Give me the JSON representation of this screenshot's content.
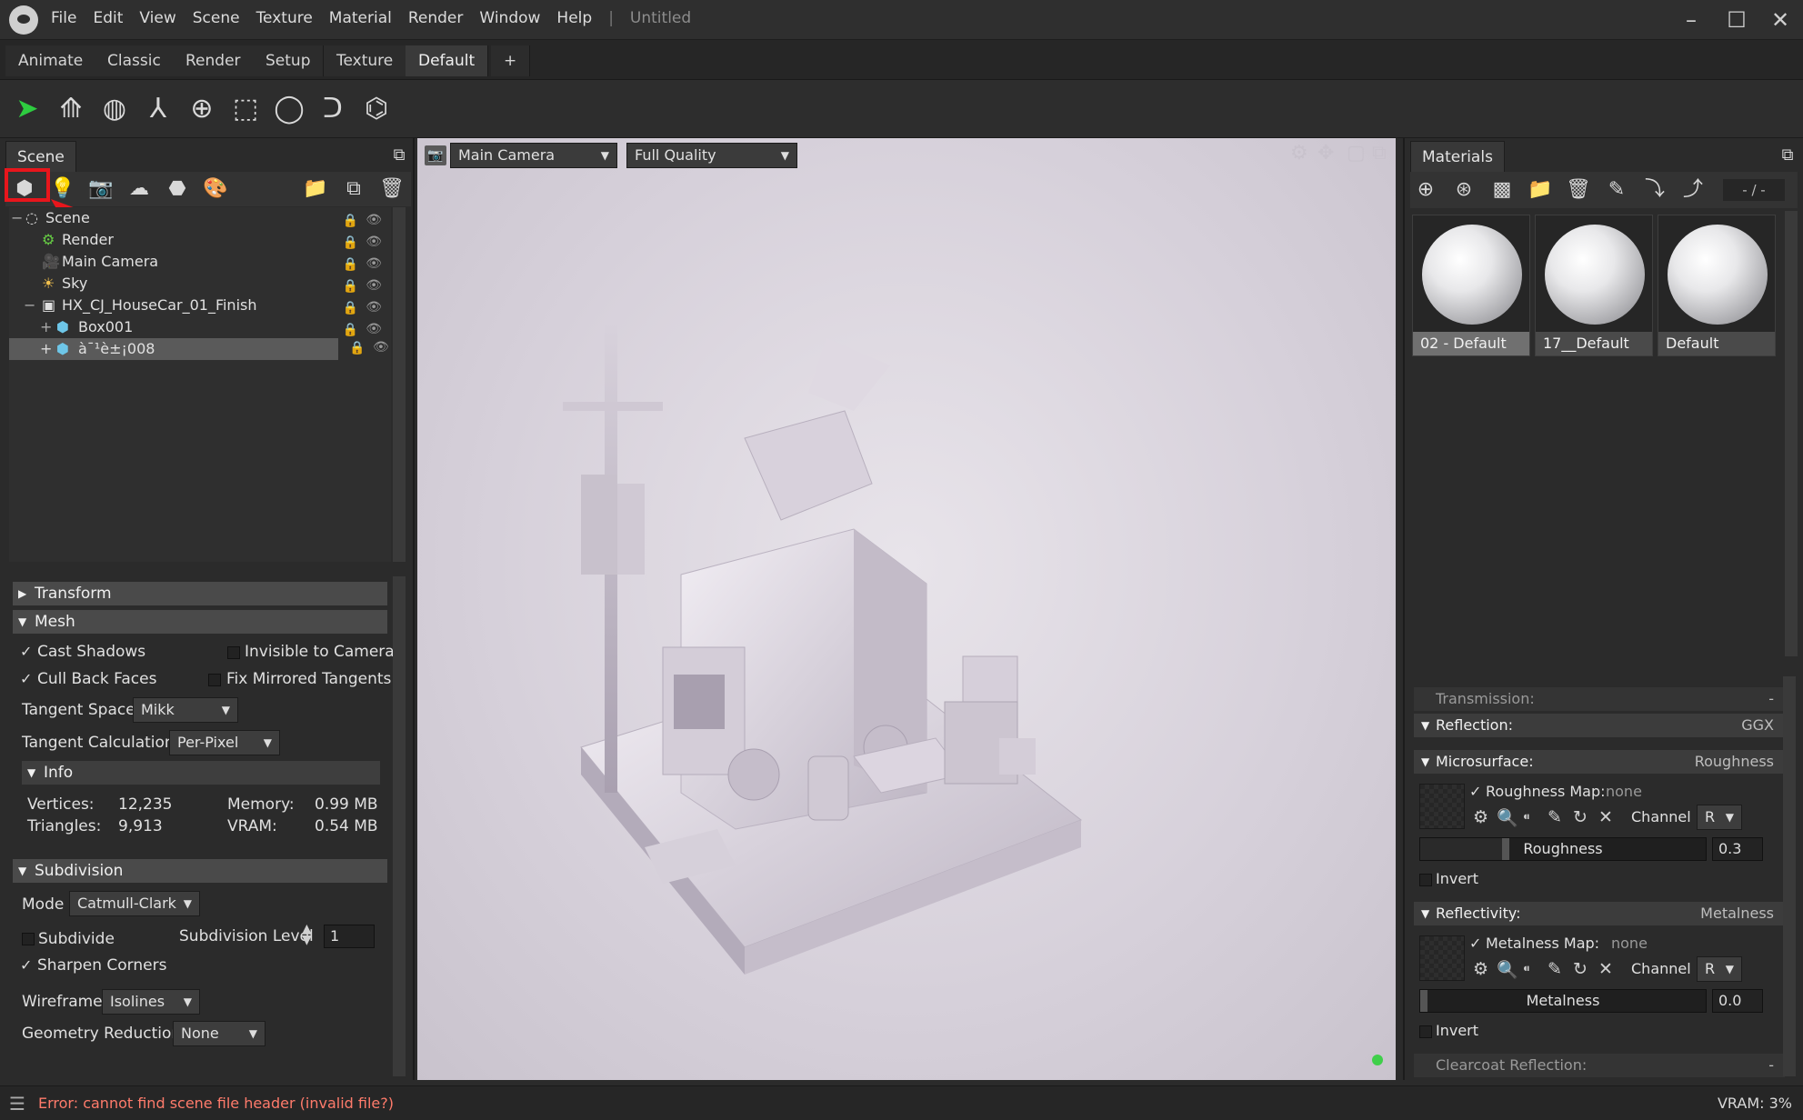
{
  "app": {
    "document_title": "Untitled"
  },
  "menu": [
    "File",
    "Edit",
    "View",
    "Scene",
    "Texture",
    "Material",
    "Render",
    "Window",
    "Help"
  ],
  "tabs": [
    "Animate",
    "Classic",
    "Render",
    "Setup",
    "Texture",
    "Default",
    "+"
  ],
  "active_tab": "Default",
  "scene_panel": {
    "tab_label": "Scene",
    "tree": [
      {
        "label": "Scene",
        "icon": "scene-icon"
      },
      {
        "label": "Render",
        "icon": "gear-icon"
      },
      {
        "label": "Main Camera",
        "icon": "camera-icon"
      },
      {
        "label": "Sky",
        "icon": "sun-icon"
      },
      {
        "label": "HX_CJ_HouseCar_01_Finish",
        "icon": "mesh-group-icon"
      },
      {
        "label": "Box001",
        "icon": "cube-icon"
      },
      {
        "label": "à¯¹è±¡008",
        "icon": "cube-icon"
      }
    ]
  },
  "properties": {
    "transform_label": "Transform",
    "mesh_label": "Mesh",
    "cast_shadows": "Cast Shadows",
    "invisible_to_camera": "Invisible to Camera",
    "cull_back_faces": "Cull Back Faces",
    "fix_mirrored_tangents": "Fix Mirrored Tangents",
    "tangent_space_label": "Tangent Space",
    "tangent_space_value": "Mikk",
    "tangent_calc_label": "Tangent Calculation",
    "tangent_calc_value": "Per-Pixel",
    "info_label": "Info",
    "vertices_label": "Vertices:",
    "vertices_value": "12,235",
    "triangles_label": "Triangles:",
    "triangles_value": "9,913",
    "memory_label": "Memory:",
    "memory_value": "0.99 MB",
    "vram_label": "VRAM:",
    "vram_value": "0.54 MB",
    "subdivision_label": "Subdivision",
    "mode_label": "Mode",
    "mode_value": "Catmull-Clark",
    "subdivide_label": "Subdivide",
    "subdivision_level_label": "Subdivision Level",
    "subdivision_level_value": "1",
    "sharpen_corners": "Sharpen Corners",
    "wireframe_label": "Wireframe",
    "wireframe_value": "Isolines",
    "geometry_reduction_label": "Geometry Reduction",
    "geometry_reduction_value": "None"
  },
  "viewport": {
    "camera": "Main Camera",
    "quality": "Full Quality"
  },
  "materials_panel": {
    "tab_label": "Materials",
    "counter": "- / -",
    "materials": [
      {
        "name": "02 - Default"
      },
      {
        "name": "17__Default"
      },
      {
        "name": "Default"
      }
    ],
    "transmission_label": "Transmission:",
    "transmission_value": "-",
    "reflection_label": "Reflection:",
    "reflection_value": "GGX",
    "microsurface_label": "Microsurface:",
    "microsurface_value": "Roughness",
    "roughness_map_label": "Roughness Map:",
    "roughness_map_value": "none",
    "channel_label": "Channel",
    "channel_value": "R",
    "roughness_label": "Roughness",
    "roughness_value": "0.3",
    "invert_label": "Invert",
    "reflectivity_label": "Reflectivity:",
    "reflectivity_value": "Metalness",
    "metalness_map_label": "Metalness Map:",
    "metalness_map_value": "none",
    "metalness_label": "Metalness",
    "metalness_value": "0.0",
    "clearcoat_label": "Clearcoat Reflection:",
    "clearcoat_value": "-"
  },
  "status": {
    "error": "Error: cannot find scene file header (invalid file?)",
    "vram": "VRAM: 3%"
  },
  "colors": {
    "error_text": "#ff7b6b",
    "annotation_red": "#e8161c",
    "select_arrow": "#2ecc40"
  }
}
